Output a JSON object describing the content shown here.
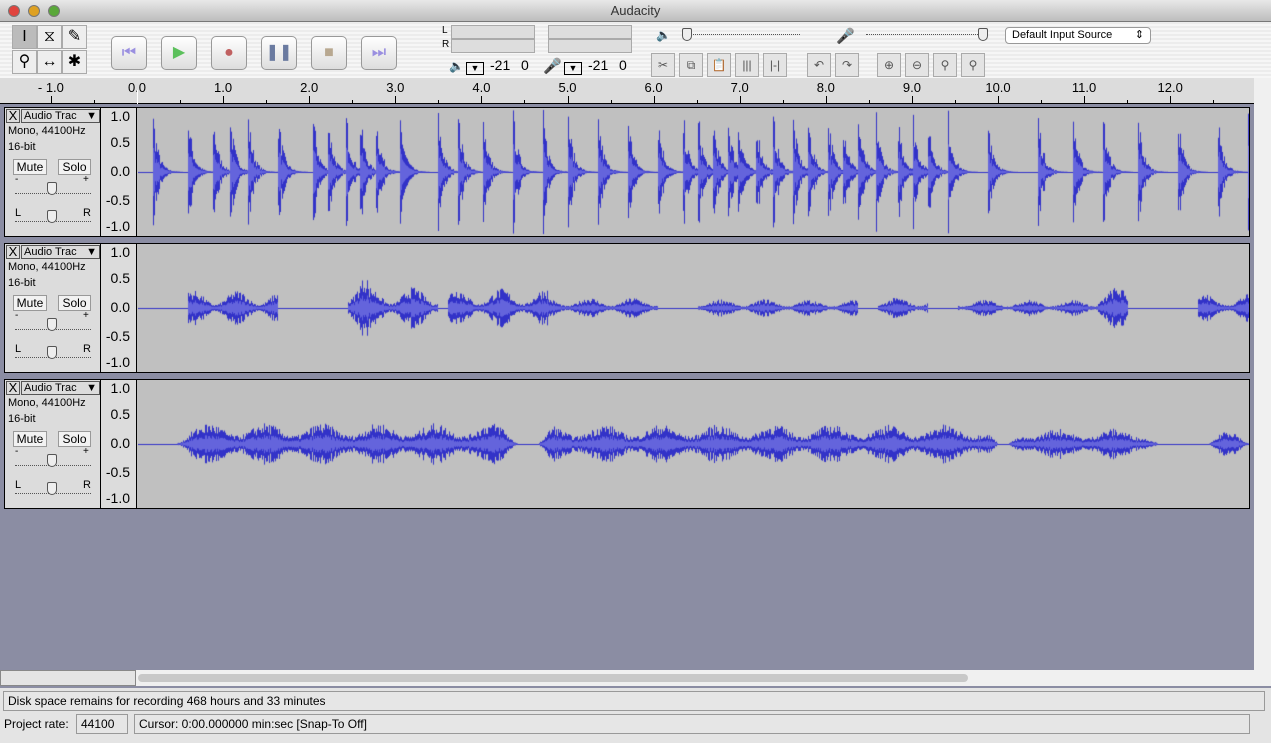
{
  "window": {
    "title": "Audacity"
  },
  "tools": [
    {
      "name": "selection-tool-icon",
      "glyph": "I"
    },
    {
      "name": "envelope-tool-icon",
      "glyph": "⧖"
    },
    {
      "name": "draw-tool-icon",
      "glyph": "✎"
    },
    {
      "name": "zoom-tool-icon",
      "glyph": "⚲"
    },
    {
      "name": "timeshift-tool-icon",
      "glyph": "↔"
    },
    {
      "name": "multi-tool-icon",
      "glyph": "✱"
    }
  ],
  "transport": [
    {
      "name": "skip-start-button",
      "glyph": "⏮",
      "color": "#9a8fe0"
    },
    {
      "name": "play-button",
      "glyph": "▶",
      "color": "#5cc05c"
    },
    {
      "name": "record-button",
      "glyph": "●",
      "color": "#c06060"
    },
    {
      "name": "pause-button",
      "glyph": "❚❚",
      "color": "#6a7aa0"
    },
    {
      "name": "stop-button",
      "glyph": "■",
      "color": "#b8a890"
    },
    {
      "name": "skip-end-button",
      "glyph": "⏭",
      "color": "#9a8fe0"
    }
  ],
  "meters": {
    "l": "L",
    "r": "R",
    "play_scale": [
      "-21",
      "0"
    ],
    "rec_scale": [
      "-21",
      "0"
    ]
  },
  "mixer": {
    "minus": "-",
    "plus": "+",
    "input_source": "Default Input Source",
    "output_volume": 0,
    "input_volume": 1
  },
  "edit_buttons": [
    {
      "name": "trim-button",
      "glyph": "✂"
    },
    {
      "name": "copy-button",
      "glyph": "⧉"
    },
    {
      "name": "paste-button",
      "glyph": "📋"
    },
    {
      "name": "trim-outside-button",
      "glyph": "|||"
    },
    {
      "name": "silence-button",
      "glyph": "|-|"
    },
    {
      "name": "undo-button",
      "glyph": "↶"
    },
    {
      "name": "redo-button",
      "glyph": "↷"
    },
    {
      "name": "zoom-in-button",
      "glyph": "⊕"
    },
    {
      "name": "zoom-out-button",
      "glyph": "⊖"
    },
    {
      "name": "fit-selection-button",
      "glyph": "⚲"
    },
    {
      "name": "fit-project-button",
      "glyph": "⚲"
    }
  ],
  "ruler": {
    "labels": [
      "- 1.0",
      "0.0",
      "1.0",
      "2.0",
      "3.0",
      "4.0",
      "5.0",
      "6.0",
      "7.0",
      "8.0",
      "9.0",
      "10.0",
      "11.0",
      "12.0"
    ],
    "values": [
      -1,
      0,
      1,
      2,
      3,
      4,
      5,
      6,
      7,
      8,
      9,
      10,
      11,
      12
    ]
  },
  "tracks": [
    {
      "name": "Audio Trac",
      "info1": "Mono, 44100Hz",
      "info2": "16-bit",
      "mute": "Mute",
      "solo": "Solo",
      "gain_minus": "-",
      "gain_plus": "+",
      "pan_l": "L",
      "pan_r": "R",
      "close": "X"
    },
    {
      "name": "Audio Trac",
      "info1": "Mono, 44100Hz",
      "info2": "16-bit",
      "mute": "Mute",
      "solo": "Solo",
      "gain_minus": "-",
      "gain_plus": "+",
      "pan_l": "L",
      "pan_r": "R",
      "close": "X"
    },
    {
      "name": "Audio Trac",
      "info1": "Mono, 44100Hz",
      "info2": "16-bit",
      "mute": "Mute",
      "solo": "Solo",
      "gain_minus": "-",
      "gain_plus": "+",
      "pan_l": "L",
      "pan_r": "R",
      "close": "X"
    }
  ],
  "amplitude_labels": [
    "1.0",
    "0.5",
    "0.0",
    "-0.5",
    "-1.0"
  ],
  "colors": {
    "waveform": "#3232c8",
    "waveform_rms": "#6464dc",
    "track_bg": "#c0c0c0",
    "workspace": "#8b8da3"
  },
  "status": {
    "disk": "Disk space remains for recording 468 hours and 33 minutes",
    "rate_label": "Project rate:",
    "rate": "44100",
    "cursor": "Cursor: 0:00.000000 min:sec   [Snap-To Off]"
  }
}
